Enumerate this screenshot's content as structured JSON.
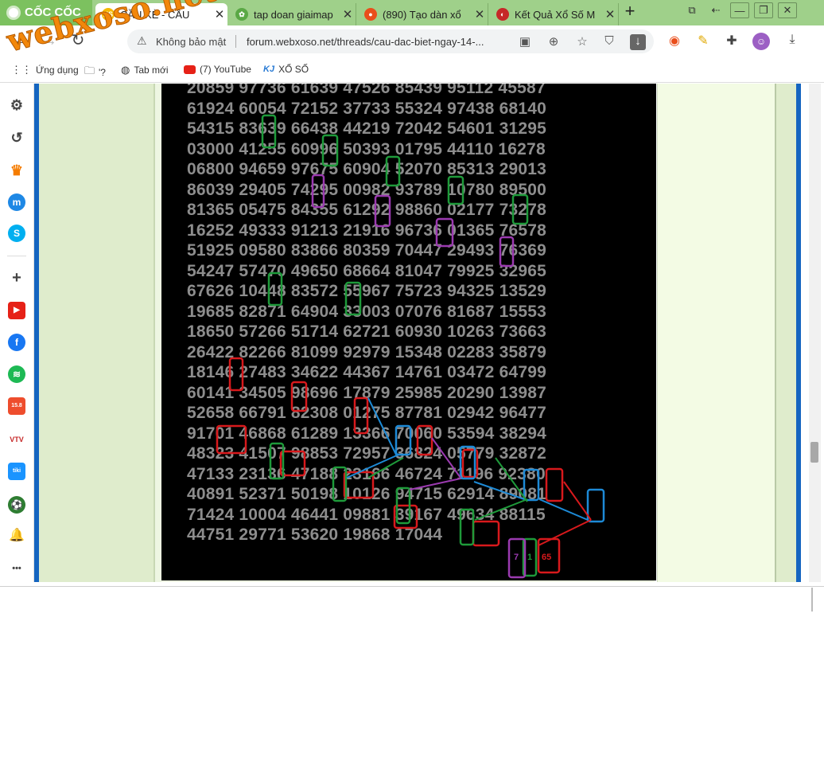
{
  "browser": {
    "brand": "CỐC CỐC",
    "tabs": [
      {
        "title": "CẦU KÈ - CẦU",
        "favicon": "xs-favicon",
        "color": "#f5b800"
      },
      {
        "title": "tap doan giaimap",
        "favicon": "leaf-favicon",
        "color": "#5aa845"
      },
      {
        "title": "(890) Tạo dàn xổ",
        "favicon": "colorful-favicon",
        "color": "#e94e1b"
      },
      {
        "title": "Kết Quả Xổ Số M",
        "favicon": "kq-favicon",
        "color": "#c62828"
      }
    ],
    "new_tab": "+",
    "url_warning": "Không bảo mật",
    "url": "forum.webxoso.net/threads/cau-dac-biet-ngay-14-..."
  },
  "bookmarks": [
    {
      "label": "Ứng dụng",
      "icon": "apps-icon"
    },
    {
      "label": "'?",
      "icon": "folder-icon"
    },
    {
      "label": "Tab mới",
      "icon": "globe-icon"
    },
    {
      "label": "(7) YouTube",
      "icon": "youtube-icon"
    },
    {
      "label": "XỔ SỐ",
      "icon": "kj-icon",
      "prefix": "KJ"
    }
  ],
  "watermark": "webxoso.net",
  "sidepanel": [
    {
      "name": "settings-icon",
      "glyph": "⚙"
    },
    {
      "name": "history-icon",
      "glyph": "↺"
    },
    {
      "name": "crown-icon",
      "glyph": "♛"
    },
    {
      "name": "messenger-icon",
      "glyph": "m"
    },
    {
      "name": "skype-icon",
      "glyph": "S"
    },
    {
      "name": "add-icon",
      "glyph": "+"
    },
    {
      "name": "youtube-icon",
      "glyph": "▶"
    },
    {
      "name": "facebook-icon",
      "glyph": "f"
    },
    {
      "name": "spotify-icon",
      "glyph": "≋"
    },
    {
      "name": "shopee-icon",
      "glyph": "15.8"
    },
    {
      "name": "vtv-icon",
      "glyph": "VTV"
    },
    {
      "name": "tiki-icon",
      "glyph": "tiki"
    },
    {
      "name": "football-icon",
      "glyph": "⚽"
    },
    {
      "name": "bell-icon",
      "glyph": "🔔"
    },
    {
      "name": "more-icon",
      "glyph": "•••"
    }
  ],
  "board": {
    "rows": [
      "20859 97736 61639 47526 85439 95112 45587",
      "61924 60054 72152 37733 55324 97438 68140",
      "54315 83639 66438 44219 72042 54601 31295",
      "03000 41255 60996 50393 01795 44110 16278",
      "06800 94659 97675 60904 52070 85313 29013",
      "86039 29405 74295 00982 93789 10780 89500",
      "81365 05475 84355 61292 98860 02177 73278",
      "16252 49333 91213 21916 96736 01365 76578",
      "51925 09580 83866 80359 70447 29493 76369",
      "54247 57470 49650 68664 81047 79925 32965",
      "67626 10448 83572 55967 75723 94325 13529",
      "19685 82871 64904 33003 07076 81687 15553",
      "18650 57266 51714 62721 60930 10263 73663",
      "26422 82266 81099 92979 15348 02283 35879",
      "18146 27483 34622 44367 14761 03472 64799",
      "60141 34505 98696 17879 25985 20290 13987",
      "52658 66791 82308 01275 87781 02942 96477",
      "91701 46868 61289 13366 70060 53594 38294",
      "48323 41507 98853 72957 36824 05779 32872",
      "47133 23136 47188 23166 46724 71196 92380",
      "40891 52371 50198 10126 94715 62914 89081",
      "71424 10004 46441 09881 39167 49634 88115",
      "44751 29771 53620 19868 17044"
    ],
    "labels": [
      "7",
      "1",
      "65"
    ]
  }
}
